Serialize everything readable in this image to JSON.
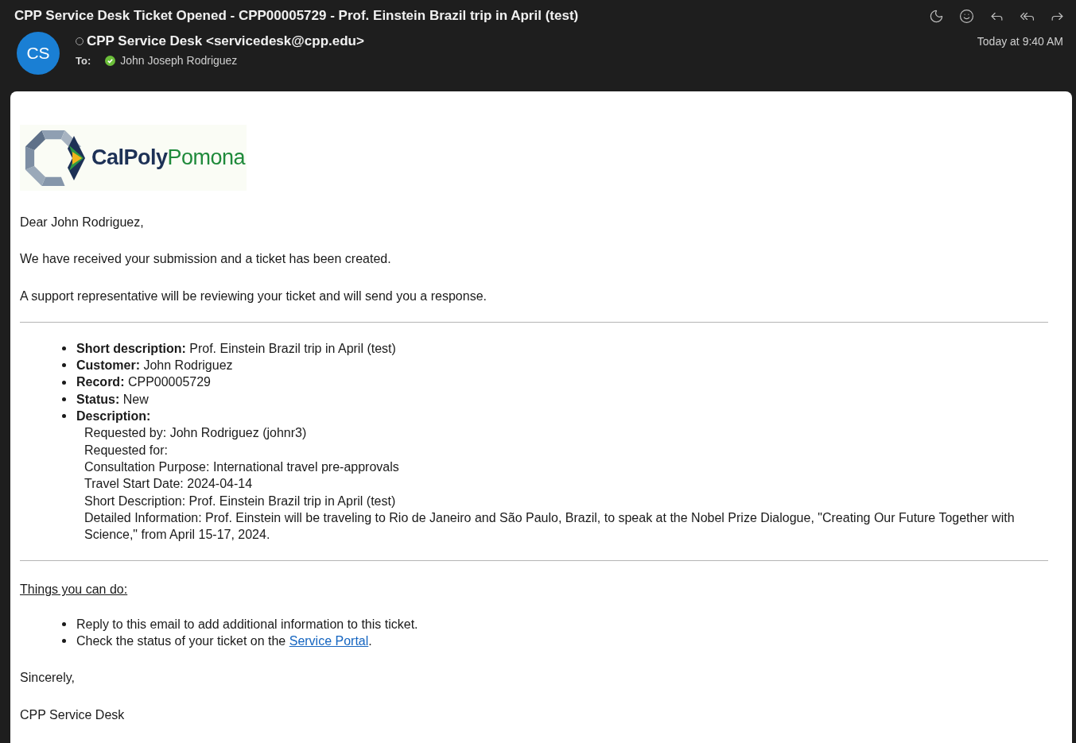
{
  "window": {
    "title": "CPP Service Desk Ticket Opened - CPP00005729 - Prof. Einstein Brazil trip in April (test)"
  },
  "header": {
    "avatar": "CS",
    "sender": "CPP Service Desk <servicedesk@cpp.edu>",
    "sender_status_online": false,
    "to_label": "To:",
    "recipient": "John Joseph Rodriguez",
    "recipient_verified": true,
    "date": "Today at 9:40 AM"
  },
  "body": {
    "logo": {
      "primary": "CalPoly",
      "secondary": "Pomona"
    },
    "greeting": "Dear John Rodriguez,",
    "paragraphs": [
      "We have received your submission and a ticket has been created.",
      "A support representative will be reviewing your ticket and will send you a response."
    ],
    "details": [
      "**Short description:** Prof. Einstein Brazil trip in April (test)",
      "**Customer:** John Rodriguez",
      "**Record:** CPP00005729",
      "**Status:** New",
      "**Description:**"
    ],
    "description_lines": [
      "Requested by: John Rodriguez (johnr3)",
      "Requested for:",
      "Consultation Purpose: International travel pre-approvals",
      "Travel Start Date: 2024-04-14",
      "Short Description: Prof. Einstein Brazil trip in April (test)",
      "Detailed Information: Prof. Einstein will be traveling to Rio de Janeiro and São Paulo, Brazil, to speak at the Nobel Prize Dialogue, \"Creating Our Future Together with Science,\" from April 15-17, 2024."
    ],
    "actions_heading": "Things you can do:",
    "actions": [
      {
        "text": "Reply to this email to add additional information to this ticket."
      },
      {
        "text": "Check the status of your ticket on the ",
        "link": "Service Portal",
        "after": "."
      }
    ],
    "closing": "Sincerely,",
    "signature": "CPP Service Desk"
  }
}
